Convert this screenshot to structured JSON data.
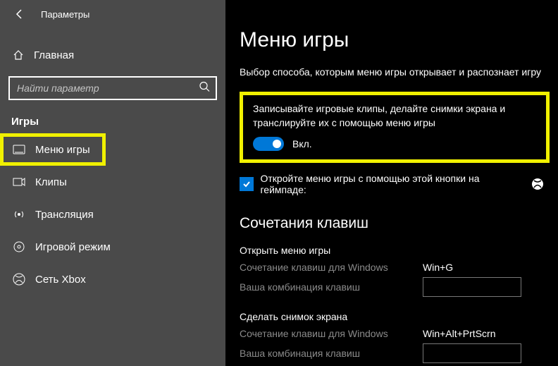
{
  "header": {
    "title": "Параметры"
  },
  "sidebar": {
    "home": "Главная",
    "search_placeholder": "Найти параметр",
    "section": "Игры",
    "items": [
      {
        "label": "Меню игры"
      },
      {
        "label": "Клипы"
      },
      {
        "label": "Трансляция"
      },
      {
        "label": "Игровой режим"
      },
      {
        "label": "Сеть Xbox"
      }
    ]
  },
  "main": {
    "title": "Меню игры",
    "subtitle": "Выбор способа, которым меню игры открывает и распознает игру",
    "box_desc": "Записывайте игровые клипы, делайте снимки экрана и транслируйте их с помощью меню игры",
    "toggle_label": "Вкл.",
    "check_label": "Откройте меню игры с помощью этой кнопки на геймпаде:",
    "shortcuts_heading": "Сочетания клавиш",
    "groups": [
      {
        "title": "Открыть меню игры",
        "win_label": "Сочетание клавиш для Windows",
        "win_value": "Win+G",
        "user_label": "Ваша комбинация клавиш"
      },
      {
        "title": "Сделать снимок экрана",
        "win_label": "Сочетание клавиш для Windows",
        "win_value": "Win+Alt+PrtScrn",
        "user_label": "Ваша комбинация клавиш"
      }
    ]
  }
}
